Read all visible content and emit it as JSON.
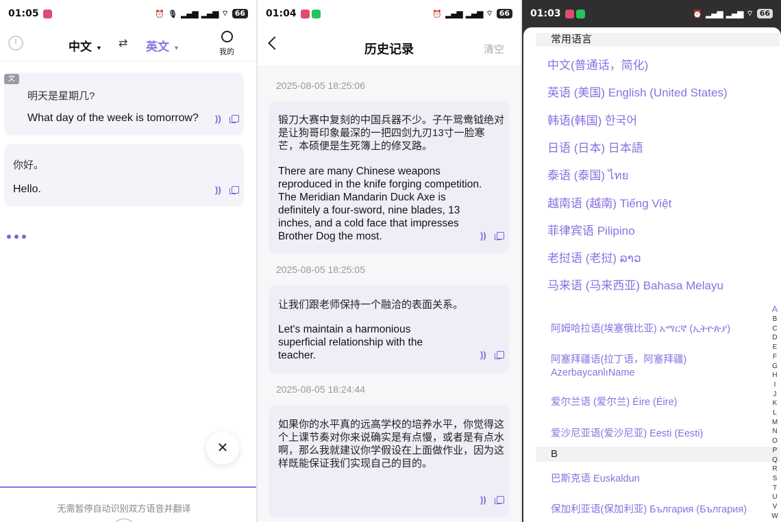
{
  "panel1": {
    "status": {
      "time": "01:05",
      "battery": "66"
    },
    "header": {
      "source_lang": "中文",
      "target_lang": "英文",
      "swap_icon": "swap-icon",
      "me_label": "我的"
    },
    "conversations": [
      {
        "badge": "文",
        "source": "明天是星期几?",
        "target": "What day of the week is tomorrow?"
      },
      {
        "source": "你好。",
        "target": "Hello."
      }
    ],
    "close_symbol": "✕",
    "hint": "无需暂停自动识别双方语音并翻译"
  },
  "panel2": {
    "status": {
      "time": "01:04",
      "battery": "66"
    },
    "title": "历史记录",
    "clear_label": "清空",
    "records": [
      {
        "timestamp": "2025-08-05 18:25:06",
        "source": "锻刀大赛中复刻的中国兵器不少。子午鸳鸯钺绝对是让狗哥印象最深的一把四剑九刃13寸一脸寒芒，本硕便是生死簿上的修叉路。",
        "target": "There are many Chinese weapons reproduced in the knife forging competition. The Meridian Mandarin Duck Axe is definitely a four-sword, nine blades, 13 inches, and a cold face that impresses Brother Dog the most."
      },
      {
        "timestamp": "2025-08-05 18:25:05",
        "source": "让我们跟老师保持一个融洽的表面关系。",
        "target": "Let's maintain a harmonious superficial relationship with the teacher."
      },
      {
        "timestamp": "2025-08-05 18:24:44",
        "source": "如果你的水平真的远高学校的培养水平，你觉得这个上课节奏对你来说确实是有点慢，或者是有点水啊，那么我就建议你学假设在上面做作业，因为这样既能保证我们实现自己的目的。",
        "target": ""
      }
    ]
  },
  "panel3": {
    "status": {
      "time": "01:03",
      "battery": "66"
    },
    "common_header": "常用语言",
    "common_languages": [
      "中文(普通话，简化)",
      "英语 (美国)   English (United States)",
      "韩语(韩国)   한국어",
      "日语 (日本)   日本語",
      "泰语 (泰国)   ไทย",
      "越南语 (越南)   Tiếng Việt",
      "菲律宾语   Pilipino",
      "老挝语 (老挝)   ລາວ",
      "马来语 (马来西亚)   Bahasa Melayu"
    ],
    "section_a_languages": [
      "阿姆哈拉语(埃塞俄比亚)   አማርኛ (ኢትዮጵያ)",
      "阿塞拜疆语(拉丁语，阿塞拜疆) AzerbaycanlıName",
      "爱尔兰语 (爱尔兰)   Éire (Éire)",
      "爱沙尼亚语(爱沙尼亚)   Eesti (Eesti)"
    ],
    "section_b_header": "B",
    "section_b_languages": [
      "巴斯克语   Euskaldun",
      "保加利亚语(保加利亚)   България (България)"
    ],
    "alphabet": [
      "A",
      "B",
      "C",
      "D",
      "E",
      "F",
      "G",
      "H",
      "I",
      "J",
      "K",
      "L",
      "M",
      "N",
      "O",
      "P",
      "Q",
      "R",
      "S",
      "T",
      "U",
      "V",
      "W"
    ]
  },
  "colors": {
    "accent": "#8a6fe0",
    "card_bg": "#f4f3f9"
  }
}
